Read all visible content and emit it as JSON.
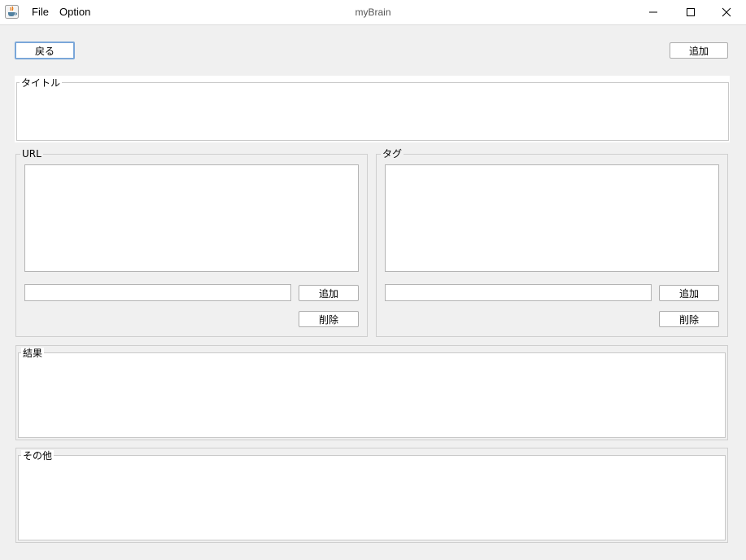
{
  "window": {
    "title": "myBrain",
    "icon": "java-cup-icon",
    "controls": {
      "minimize": "minimize-icon",
      "maximize": "maximize-icon",
      "close": "close-icon"
    }
  },
  "menu": [
    {
      "label": "File"
    },
    {
      "label": "Option"
    }
  ],
  "toolbar": {
    "back_label": "戻る",
    "add_label": "追加"
  },
  "title_section": {
    "legend": "タイトル",
    "value": ""
  },
  "url_section": {
    "legend": "URL",
    "input_value": "",
    "add_label": "追加",
    "delete_label": "削除"
  },
  "tag_section": {
    "legend": "タグ",
    "input_value": "",
    "add_label": "追加",
    "delete_label": "削除"
  },
  "result_section": {
    "legend": "結果",
    "value": ""
  },
  "other_section": {
    "legend": "その他",
    "value": ""
  },
  "colors": {
    "window_bg": "#f0f0f0",
    "titlebar_bg": "#ffffff",
    "focus_border": "#7aa7d9"
  }
}
